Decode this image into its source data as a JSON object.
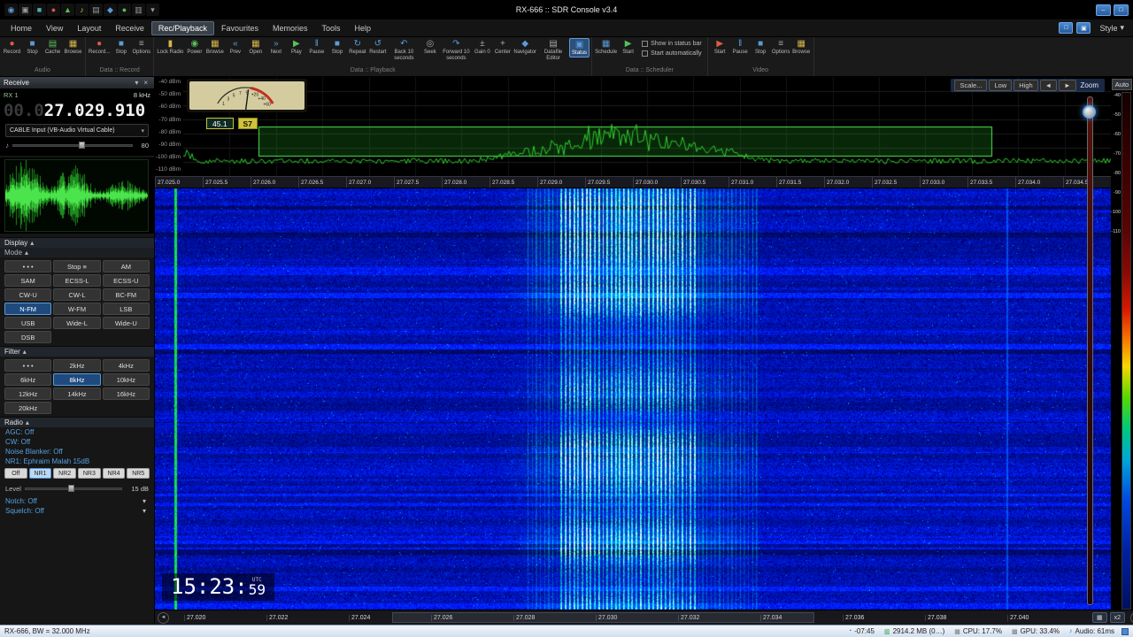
{
  "window": {
    "title": "RX-666 :: SDR Console v3.4"
  },
  "icons": {
    "close": "×",
    "collapse": "▾",
    "expand": "▴",
    "caret": "▾",
    "speaker": "♪",
    "arrow_left": "◄",
    "arrow_right": "►",
    "grid": "▦"
  },
  "titlebar": {
    "quick_icons": [
      {
        "g": "◉",
        "cls": "q-blue"
      },
      {
        "g": "▣",
        "cls": "q-gray"
      },
      {
        "g": "■",
        "cls": "q-teal"
      },
      {
        "g": "●",
        "cls": "q-red"
      },
      {
        "g": "▲",
        "cls": "q-green"
      },
      {
        "g": "♪",
        "cls": "q-yellow"
      },
      {
        "g": "▤",
        "cls": "q-gray"
      },
      {
        "g": "◆",
        "cls": "q-blue"
      },
      {
        "g": "●",
        "cls": "q-green"
      },
      {
        "g": "▥",
        "cls": "q-gray"
      },
      {
        "g": "▾",
        "cls": "q-gray"
      }
    ],
    "win_buttons": [
      {
        "g": "–"
      },
      {
        "g": "□"
      }
    ]
  },
  "menubar": {
    "tabs": [
      {
        "label": "Home"
      },
      {
        "label": "View"
      },
      {
        "label": "Layout"
      },
      {
        "label": "Receive"
      },
      {
        "label": "Rec/Playback",
        "sel": true
      },
      {
        "label": "Favourites"
      },
      {
        "label": "Memories"
      },
      {
        "label": "Tools"
      },
      {
        "label": "Help"
      }
    ],
    "style_label": "Style"
  },
  "ribbon": {
    "audio": {
      "caption": "Audio",
      "buttons": [
        {
          "label": "Record",
          "icon": "●",
          "cls": "ic-red"
        },
        {
          "label": "Stop",
          "icon": "■",
          "cls": "ic-blue"
        },
        {
          "label": "Cache",
          "icon": "▤",
          "cls": "ic-green"
        },
        {
          "label": "Browse",
          "icon": "▦",
          "cls": "ic-yellow"
        }
      ]
    },
    "data_record": {
      "caption": "Data :: Record",
      "buttons": [
        {
          "label": "Record...",
          "icon": "●",
          "cls": "ic-red"
        },
        {
          "label": "Stop",
          "icon": "■",
          "cls": "ic-blue"
        },
        {
          "label": "Options",
          "icon": "≡",
          "cls": "ic-gray"
        }
      ]
    },
    "data_playback": {
      "caption": "Data :: Playback",
      "buttons": [
        {
          "label": "Lock Radio",
          "icon": "▮",
          "cls": "ic-yellow"
        },
        {
          "label": "Power",
          "icon": "◉",
          "cls": "ic-green"
        },
        {
          "label": "Browse",
          "icon": "▦",
          "cls": "ic-yellow"
        },
        {
          "label": "Prev",
          "icon": "«",
          "cls": "ic-blue"
        },
        {
          "label": "Open",
          "icon": "▦",
          "cls": "ic-yellow"
        },
        {
          "label": "Next",
          "icon": "»",
          "cls": "ic-blue"
        },
        {
          "label": "Play",
          "icon": "▶",
          "cls": "ic-green"
        },
        {
          "label": "Pause",
          "icon": "‖",
          "cls": "ic-blue"
        },
        {
          "label": "Stop",
          "icon": "■",
          "cls": "ic-blue"
        },
        {
          "label": "Repeat",
          "icon": "↻",
          "cls": "ic-blue"
        },
        {
          "label": "Restart",
          "icon": "↺",
          "cls": "ic-blue"
        },
        {
          "label": "Back 10 seconds",
          "icon": "↶",
          "cls": "ic-blue"
        },
        {
          "label": "Seek",
          "icon": "◎",
          "cls": "ic-gray"
        },
        {
          "label": "Forward 10 seconds",
          "icon": "↷",
          "cls": "ic-blue"
        },
        {
          "label": "Gain 0",
          "icon": "±",
          "cls": "ic-gray"
        },
        {
          "label": "Center",
          "icon": "+",
          "cls": "ic-gray"
        },
        {
          "label": "Navigator",
          "icon": "◆",
          "cls": "ic-blue"
        },
        {
          "label": "Datafile Editor",
          "icon": "▤",
          "cls": "ic-gray"
        },
        {
          "label": "Status",
          "icon": "▣",
          "cls": "ic-blue",
          "sel": true
        }
      ]
    },
    "data_scheduler": {
      "caption": "Data :: Scheduler",
      "buttons": [
        {
          "label": "Schedule",
          "icon": "▦",
          "cls": "ic-blue"
        },
        {
          "label": "Start",
          "icon": "▶",
          "cls": "ic-green"
        }
      ],
      "checks": [
        {
          "label": "Show in status bar"
        },
        {
          "label": "Start automatically"
        }
      ]
    },
    "video": {
      "caption": "Video",
      "buttons": [
        {
          "label": "Start",
          "icon": "▶",
          "cls": "ic-red"
        },
        {
          "label": "Pause",
          "icon": "‖",
          "cls": "ic-blue"
        },
        {
          "label": "Stop",
          "icon": "■",
          "cls": "ic-blue"
        },
        {
          "label": "Options",
          "icon": "≡",
          "cls": "ic-gray"
        },
        {
          "label": "Browse",
          "icon": "▦",
          "cls": "ic-yellow"
        }
      ]
    }
  },
  "sidebar": {
    "receive_title": "Receive",
    "rx_label": "RX 1",
    "bandwidth": "8 kHz",
    "freq_prefix": "00.0",
    "frequency": "27.029.910",
    "input_device": "CABLE Input (VB-Audio Virtual Cable)",
    "volume": "80",
    "display_header": "Display",
    "mode_header": "Mode",
    "mode_buttons": [
      {
        "label": "• • •"
      },
      {
        "label": "Stop ≡"
      },
      {
        "label": "AM"
      },
      {
        "label": "SAM"
      },
      {
        "label": "ECSS-L"
      },
      {
        "label": "ECSS-U"
      },
      {
        "label": "CW-U"
      },
      {
        "label": "CW-L"
      },
      {
        "label": "BC-FM"
      },
      {
        "label": "N-FM",
        "sel": true
      },
      {
        "label": "W-FM"
      },
      {
        "label": "LSB"
      },
      {
        "label": "USB"
      },
      {
        "label": "Wide-L"
      },
      {
        "label": "Wide-U"
      },
      {
        "label": "DSB"
      }
    ],
    "filter_header": "Filter",
    "filter_buttons": [
      {
        "label": "• • •"
      },
      {
        "label": "2kHz"
      },
      {
        "label": "4kHz"
      },
      {
        "label": "6kHz"
      },
      {
        "label": "8kHz",
        "sel": true
      },
      {
        "label": "10kHz"
      },
      {
        "label": "12kHz"
      },
      {
        "label": "14kHz"
      },
      {
        "label": "16kHz"
      },
      {
        "label": "20kHz"
      }
    ],
    "radio_header": "Radio",
    "radio_links": [
      "AGC: Off",
      "CW: Off",
      "Noise Blanker: Off",
      "NR1: Ephraim Malah 15dB"
    ],
    "nr_buttons": [
      {
        "label": "Off"
      },
      {
        "label": "NR1",
        "sel": true
      },
      {
        "label": "NR2"
      },
      {
        "label": "NR3"
      },
      {
        "label": "NR4"
      },
      {
        "label": "NR5"
      }
    ],
    "level_label": "Level",
    "level_value": "15 dB",
    "notch_label": "Notch: Off",
    "squelch_label": "Squelch: Off"
  },
  "spectrum": {
    "dbm_labels": [
      "-40 dBm",
      "-50 dBm",
      "-60 dBm",
      "-70 dBm",
      "-80 dBm",
      "-90 dBm",
      "-100 dBm",
      "-110 dBm"
    ],
    "smeter": {
      "value": "45.1",
      "s_units": "S7",
      "ticks": [
        "1",
        "3",
        "5",
        "7",
        "9",
        "+20",
        "+40",
        "+60"
      ]
    },
    "controls": [
      {
        "label": "Scale..."
      },
      {
        "label": "Low"
      },
      {
        "label": "High"
      },
      {
        "label": "◄"
      },
      {
        "label": "►"
      }
    ],
    "zoom_label": "Zoom",
    "auto_label": "Auto",
    "top_scale": [
      "27.025.0",
      "27.025.5",
      "27.026.0",
      "27.026.5",
      "27.027.0",
      "27.027.5",
      "27.028.0",
      "27.028.5",
      "27.029.0",
      "27.029.5",
      "27.030.0",
      "27.030.5",
      "27.031.0",
      "27.031.5",
      "27.032.0",
      "27.032.5",
      "27.033.0",
      "27.033.5",
      "27.034.0",
      "27.034.5"
    ]
  },
  "waterfall": {
    "time_main": "15:23:",
    "time_sec": "59",
    "utc_label": "UTC",
    "bottom_scale": [
      "27.020",
      "27.022",
      "27.024",
      "27.026",
      "27.028",
      "27.030",
      "27.032",
      "27.034",
      "27.036",
      "27.038",
      "27.040"
    ],
    "zoom_x_label": "x2"
  },
  "colorbar": {
    "labels": [
      "-40",
      "-50",
      "-60",
      "-70",
      "-80",
      "-90",
      "-100",
      "-110"
    ]
  },
  "statusbar": {
    "left": "RX-666, BW = 32.000 MHz",
    "items": [
      {
        "icon": "◔",
        "label": "-07:45",
        "cls": "st-blue"
      },
      {
        "icon": "▥",
        "label": "2914.2 MB (0…)",
        "cls": "st-green"
      },
      {
        "icon": "▦",
        "label": "CPU: 17.7%",
        "cls": "st-gray"
      },
      {
        "icon": "▩",
        "label": "GPU: 33.4%",
        "cls": "st-gray"
      },
      {
        "icon": "♪",
        "label": "Audio: 61ms",
        "cls": "st-blue"
      }
    ]
  }
}
